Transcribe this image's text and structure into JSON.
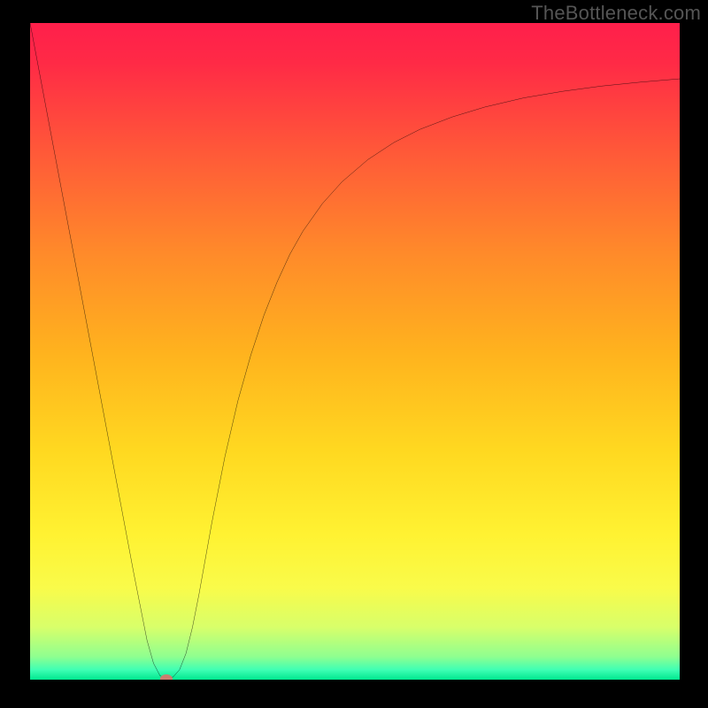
{
  "watermark": "TheBottleneck.com",
  "chart_data": {
    "type": "line",
    "title": "",
    "xlabel": "",
    "ylabel": "",
    "xlim": [
      0,
      100
    ],
    "ylim": [
      0,
      100
    ],
    "gradient_stops": [
      {
        "offset": 0.0,
        "color": "#ff1f4b"
      },
      {
        "offset": 0.06,
        "color": "#ff2a46"
      },
      {
        "offset": 0.2,
        "color": "#ff5a38"
      },
      {
        "offset": 0.35,
        "color": "#ff8a2a"
      },
      {
        "offset": 0.5,
        "color": "#ffb21e"
      },
      {
        "offset": 0.65,
        "color": "#ffd820"
      },
      {
        "offset": 0.78,
        "color": "#fff232"
      },
      {
        "offset": 0.86,
        "color": "#f9fb4a"
      },
      {
        "offset": 0.92,
        "color": "#d8ff6a"
      },
      {
        "offset": 0.965,
        "color": "#8fff90"
      },
      {
        "offset": 0.985,
        "color": "#3fffb4"
      },
      {
        "offset": 1.0,
        "color": "#00e88f"
      }
    ],
    "series": [
      {
        "name": "bottleneck-curve",
        "color": "#000000",
        "x": [
          0,
          2,
          4,
          6,
          8,
          10,
          12,
          14,
          16,
          18,
          19,
          20,
          21,
          22,
          23,
          24,
          25,
          26,
          28,
          30,
          32,
          34,
          36,
          38,
          40,
          42,
          45,
          48,
          52,
          56,
          60,
          65,
          70,
          76,
          82,
          88,
          94,
          100
        ],
        "y": [
          100,
          89.5,
          79.0,
          68.5,
          58.0,
          47.5,
          37.0,
          26.5,
          16.0,
          6.0,
          2.5,
          0.6,
          0.2,
          0.4,
          1.5,
          4.0,
          8.0,
          13.0,
          24.0,
          34.0,
          42.5,
          49.5,
          55.5,
          60.5,
          64.8,
          68.3,
          72.5,
          75.8,
          79.2,
          81.8,
          83.8,
          85.7,
          87.2,
          88.6,
          89.6,
          90.4,
          91.0,
          91.5
        ]
      }
    ],
    "marker": {
      "color": "#c97f6f",
      "x": 21.0,
      "y": 0.2
    }
  }
}
